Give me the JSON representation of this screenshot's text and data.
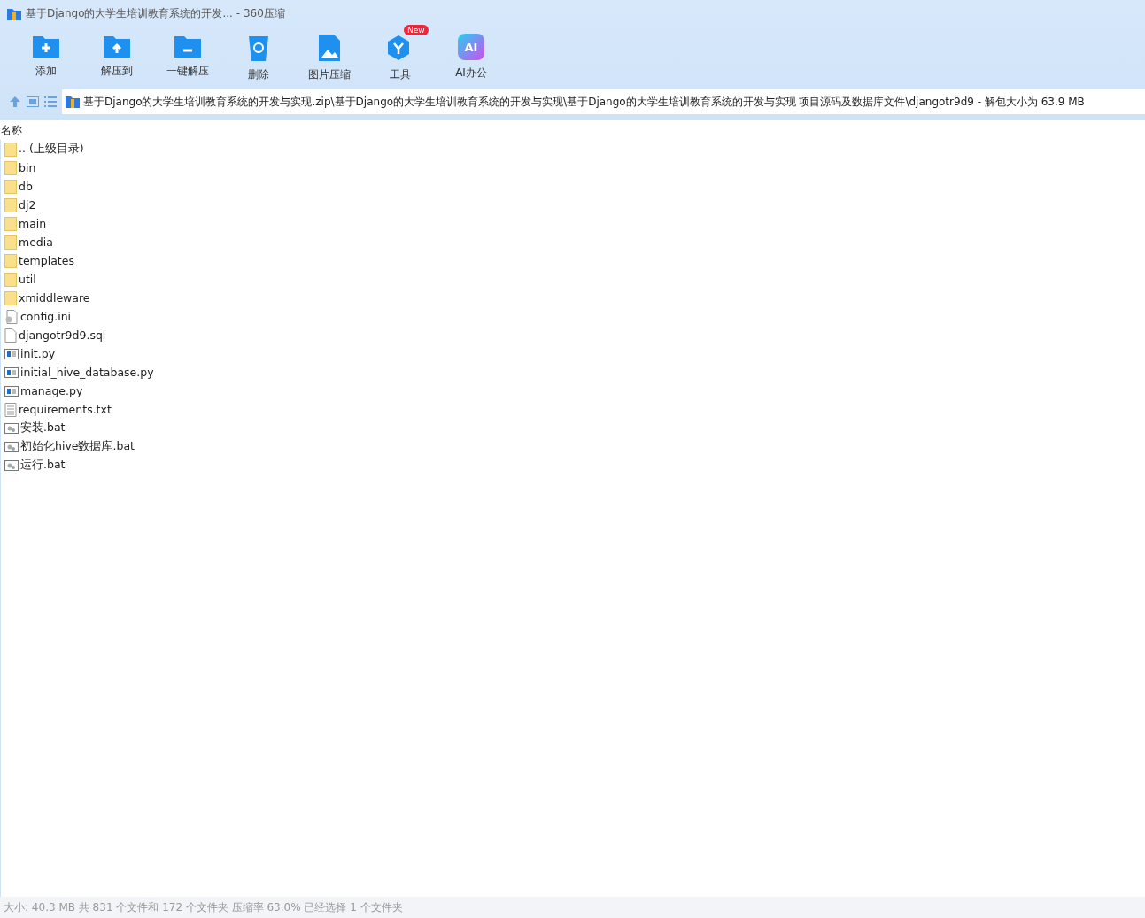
{
  "window": {
    "title": "基于Django的大学生培训教育系统的开发... - 360压缩"
  },
  "toolbar": [
    {
      "label": "添加",
      "kind": "add"
    },
    {
      "label": "解压到",
      "kind": "extract"
    },
    {
      "label": "一键解压",
      "kind": "oneclick"
    },
    {
      "label": "删除",
      "kind": "delete"
    },
    {
      "label": "图片压缩",
      "kind": "image"
    },
    {
      "label": "工具",
      "kind": "tools",
      "badge": "New"
    },
    {
      "label": "AI办公",
      "kind": "ai",
      "icon_text": "AI"
    }
  ],
  "address": {
    "path": "基于Django的大学生培训教育系统的开发与实现.zip\\基于Django的大学生培训教育系统的开发与实现\\基于Django的大学生培训教育系统的开发与实现 项目源码及数据库文件\\djangotr9d9 - 解包大小为 63.9 MB"
  },
  "list": {
    "column": "名称",
    "rows": [
      {
        "name": ".. (上级目录)",
        "kind": "folder"
      },
      {
        "name": "bin",
        "kind": "folder"
      },
      {
        "name": "db",
        "kind": "folder"
      },
      {
        "name": "dj2",
        "kind": "folder"
      },
      {
        "name": "main",
        "kind": "folder"
      },
      {
        "name": "media",
        "kind": "folder"
      },
      {
        "name": "templates",
        "kind": "folder"
      },
      {
        "name": "util",
        "kind": "folder"
      },
      {
        "name": "xmiddleware",
        "kind": "folder"
      },
      {
        "name": "config.ini",
        "kind": "config"
      },
      {
        "name": "djangotr9d9.sql",
        "kind": "file"
      },
      {
        "name": "init.py",
        "kind": "script"
      },
      {
        "name": "initial_hive_database.py",
        "kind": "script"
      },
      {
        "name": "manage.py",
        "kind": "script"
      },
      {
        "name": "requirements.txt",
        "kind": "text"
      },
      {
        "name": "安装.bat",
        "kind": "batch"
      },
      {
        "name": "初始化hive数据库.bat",
        "kind": "batch"
      },
      {
        "name": "运行.bat",
        "kind": "batch"
      }
    ]
  },
  "status_bar": "大小: 40.3 MB 共 831 个文件和 172 个文件夹 压缩率 63.0% 已经选择 1 个文件夹"
}
